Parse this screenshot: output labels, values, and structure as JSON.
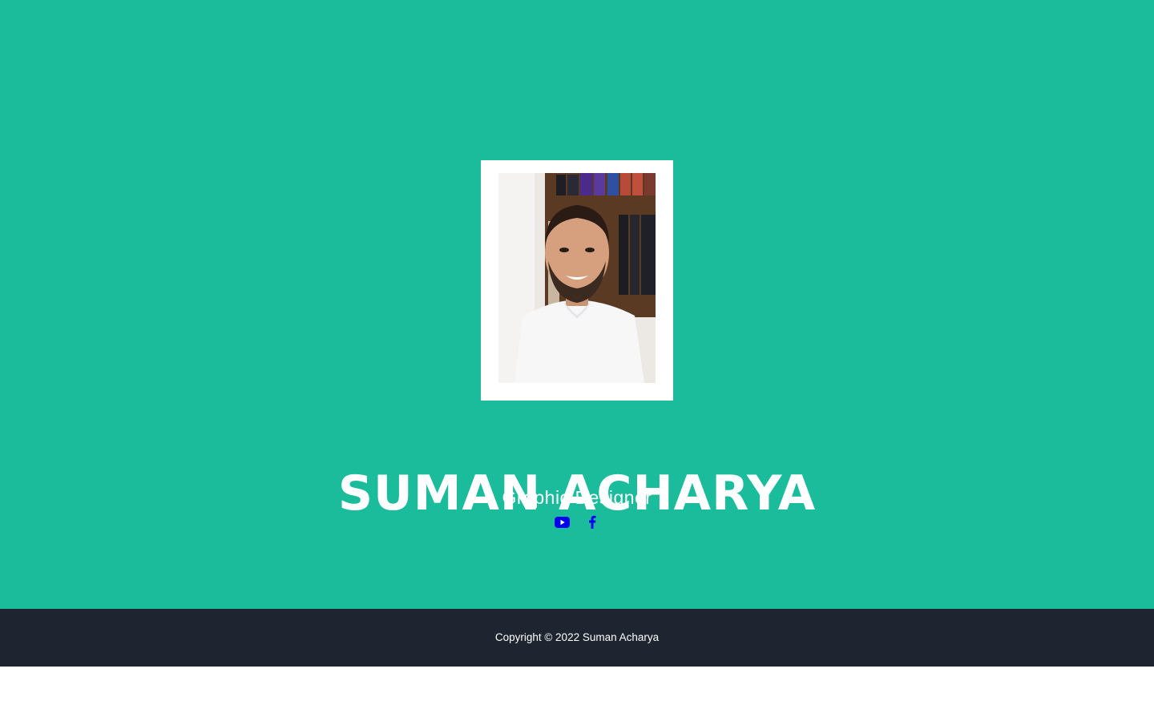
{
  "profile": {
    "name": "SUMAN ACHARYA",
    "role": "Graphic Designer",
    "photo_icon": "profile-photo"
  },
  "social": {
    "links": [
      {
        "icon": "youtube-icon"
      },
      {
        "icon": "facebook-icon"
      }
    ],
    "icon_color": "#0000ee"
  },
  "footer": {
    "copyright": "Copyright © 2022 Suman Acharya"
  },
  "colors": {
    "hero_bg": "#1abc9c",
    "footer_bg": "#1f2530",
    "text": "#ffffff"
  }
}
